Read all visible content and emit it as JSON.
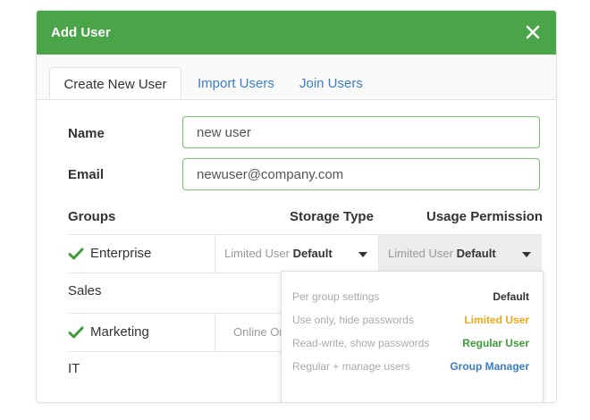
{
  "dialog": {
    "title": "Add User"
  },
  "tabs": [
    {
      "label": "Create New User"
    },
    {
      "label": "Import Users"
    },
    {
      "label": "Join Users"
    }
  ],
  "form": {
    "name_label": "Name",
    "name_value": "new user",
    "email_label": "Email",
    "email_value": "newuser@company.com",
    "groups_header": "Groups",
    "storage_header": "Storage Type",
    "usage_header": "Usage Permission"
  },
  "groups": [
    {
      "name": "Enterprise",
      "checked": true,
      "storage_prefix": "Limited User",
      "storage_value": "Default",
      "usage_prefix": "Limited User",
      "usage_value": "Default"
    },
    {
      "name": "Sales",
      "checked": false
    },
    {
      "name": "Marketing",
      "checked": true,
      "storage_prefix": "Online Or"
    },
    {
      "name": "IT",
      "checked": false
    }
  ],
  "dropdown_options": [
    {
      "description": "Per group settings",
      "role": "Default",
      "color": "#333333"
    },
    {
      "description": "Use only, hide passwords",
      "role": "Limited User",
      "color": "#f0a81a"
    },
    {
      "description": "Read-write, show passwords",
      "role": "Regular User",
      "color": "#3d9b3a"
    },
    {
      "description": "Regular + manage users",
      "role": "Group Manager",
      "color": "#3c7dc4"
    }
  ],
  "colors": {
    "header": "#4aa548",
    "link": "#3c7dc4",
    "input_border": "#79c06f"
  }
}
